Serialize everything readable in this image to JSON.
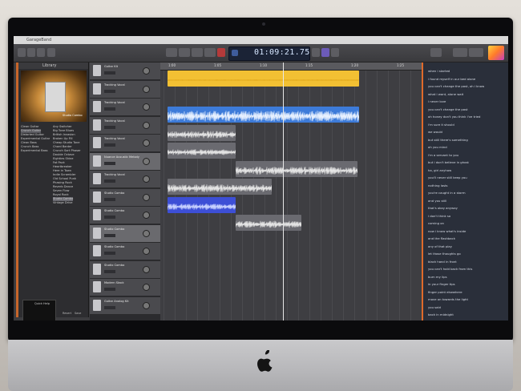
{
  "window": {
    "title": "GarageBand"
  },
  "transport": {
    "time": "01:09:21.75"
  },
  "library": {
    "title": "Library",
    "preset_name": "Studio Combo",
    "categories": [
      "Clean Guitar",
      "Crunch Guitar",
      "Distorted Guitar",
      "Experimental Guitar",
      "Clean Bass",
      "Crunch Bass",
      "Experimental Bass"
    ],
    "presets": [
      "Any Switcher",
      "Big Tone Blues",
      "British Invasion",
      "Broken Up Fill",
      "Cheap Studio Tone",
      "Chord Banter",
      "Crunch Sort Phaser",
      "Double Octave",
      "Eighties Shine",
      "Fat Pack",
      "Heartbreaker",
      "Here in Town",
      "Indie Scrambler",
      "Old School Punk",
      "Phasing Rock",
      "Reverb Dance",
      "Seven Flow",
      "Royal Rock",
      "Studio Combo",
      "Vintage Drive"
    ],
    "info_title": "Quick Help",
    "buttons": [
      "Revert",
      "Save"
    ]
  },
  "tracks": [
    {
      "name": "Guitar Kit"
    },
    {
      "name": "Tracking Vocal"
    },
    {
      "name": "Tracking Vocal"
    },
    {
      "name": "Tracking Vocal"
    },
    {
      "name": "Tracking Vocal"
    },
    {
      "name": "Nuance Acoustic Melody"
    },
    {
      "name": "Tracking Vocal"
    },
    {
      "name": "Studio Combo"
    },
    {
      "name": "Studio Combo"
    },
    {
      "name": "Studio Combo"
    },
    {
      "name": "Studio Combo"
    },
    {
      "name": "Studio Combo"
    },
    {
      "name": "Modern Stack"
    },
    {
      "name": "Guitar Analog Kit"
    }
  ],
  "ruler": [
    "1:00",
    "1:05",
    "1:10",
    "1:15",
    "1:20",
    "1:25",
    "1:30"
  ],
  "lyrics": [
    "when i started",
    "i found myself in our bed alone",
    "you can't change the past, oh i know",
    "what i want, alone wait",
    "i never love",
    "you can't change the past",
    "oh honey don't you think i've tried",
    "i'm sure it should",
    "we would",
    "but still there's something",
    "oh you mind",
    "i'm a servant to you",
    "but i don't believe in ghost",
    "ha, girl anyhow",
    "you'll never still keep you",
    "nothing lasts",
    "you're caught in a storm",
    "and you still",
    "that's okay anyway",
    "i don't think so",
    "coming on",
    "now i know what's inside",
    "and the flashback",
    "any of that play",
    "let those thoughts go",
    "black hand in front",
    "you can't hold back from this",
    "burn my lips",
    "in your finger tips",
    "finger point elsewhere",
    "move on towards the light",
    "you said",
    "back in midnight"
  ]
}
